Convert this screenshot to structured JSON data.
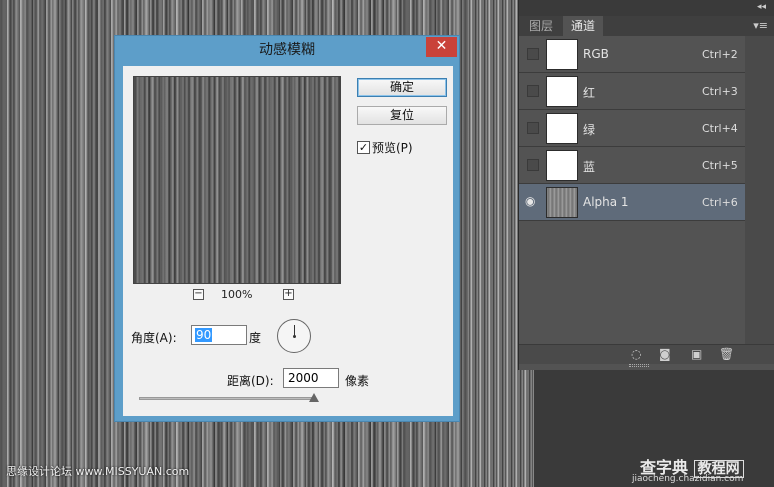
{
  "dialog": {
    "title": "动感模糊",
    "close": "✕",
    "ok_label": "确定",
    "reset_label": "复位",
    "preview_label": "预览(P)",
    "preview_checked": true,
    "zoom_minus": "−",
    "zoom_plus": "+",
    "zoom_level": "100%",
    "angle_label": "角度(A):",
    "angle_value": "90",
    "angle_unit": "度",
    "distance_label": "距离(D):",
    "distance_value": "2000",
    "distance_unit": "像素",
    "distance_slider_fraction": 1.0
  },
  "panel": {
    "collapse_icon": "◂◂",
    "tabs": [
      {
        "label": "图层",
        "active": false
      },
      {
        "label": "通道",
        "active": true
      }
    ],
    "menu_icon": "▾≡",
    "channels": [
      {
        "name": "RGB",
        "shortcut": "Ctrl+2",
        "visible": false,
        "selected": false
      },
      {
        "name": "红",
        "shortcut": "Ctrl+3",
        "visible": false,
        "selected": false
      },
      {
        "name": "绿",
        "shortcut": "Ctrl+4",
        "visible": false,
        "selected": false
      },
      {
        "name": "蓝",
        "shortcut": "Ctrl+5",
        "visible": false,
        "selected": false
      },
      {
        "name": "Alpha 1",
        "shortcut": "Ctrl+6",
        "visible": true,
        "selected": true
      }
    ],
    "eye_icon": "◉",
    "footer_icons": [
      "load-selection-icon",
      "save-selection-icon",
      "new-channel-icon",
      "delete-channel-icon"
    ]
  },
  "watermarks": {
    "left": "思缘设计论坛 www.MISSYUAN.com",
    "right_main": "查字典",
    "right_box": "教程网",
    "right_url": "jiaocheng.chazidian.com"
  }
}
